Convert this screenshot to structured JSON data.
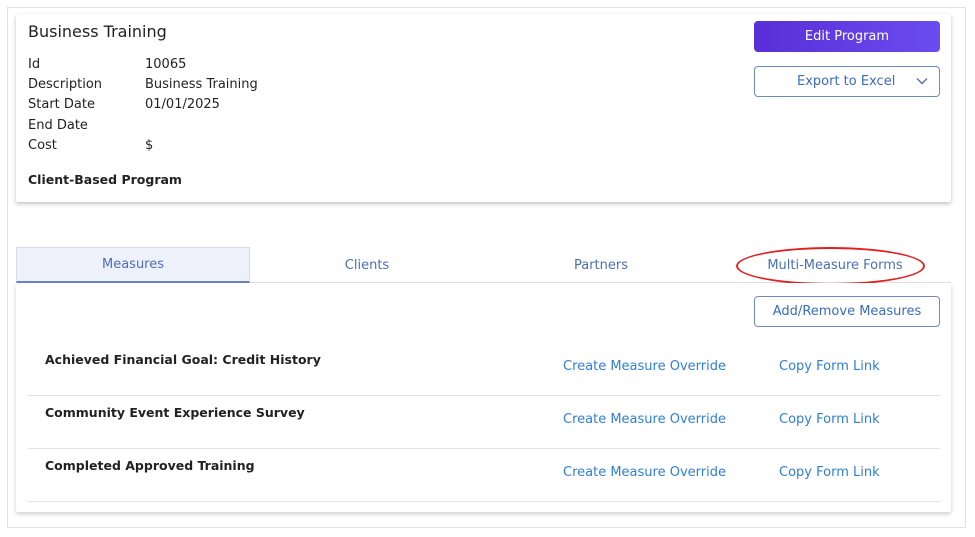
{
  "program": {
    "title": "Business Training",
    "fields": [
      {
        "label": "Id",
        "value": "10065"
      },
      {
        "label": "Description",
        "value": "Business Training"
      },
      {
        "label": "Start Date",
        "value": "01/01/2025"
      },
      {
        "label": "End Date",
        "value": ""
      },
      {
        "label": "Cost",
        "value": "$"
      }
    ],
    "type_label": "Client-Based Program"
  },
  "actions": {
    "edit_label": "Edit Program",
    "export_label": "Export to Excel",
    "export_icon": "chevron-down-icon"
  },
  "tabs": [
    {
      "label": "Measures",
      "active": true
    },
    {
      "label": "Clients",
      "active": false
    },
    {
      "label": "Partners",
      "active": false
    },
    {
      "label": "Multi-Measure Forms",
      "active": false,
      "highlighted": true
    }
  ],
  "measures": {
    "add_remove_label": "Add/Remove Measures",
    "rows": [
      {
        "name": "Achieved Financial Goal: Credit History",
        "override_label": "Create Measure Override",
        "copy_label": "Copy Form Link"
      },
      {
        "name": "Community Event Experience Survey",
        "override_label": "Create Measure Override",
        "copy_label": "Copy Form Link"
      },
      {
        "name": "Completed Approved Training",
        "override_label": "Create Measure Override",
        "copy_label": "Copy Form Link"
      }
    ]
  },
  "colors": {
    "primary_gradient_start": "#5a2ed8",
    "primary_gradient_end": "#6a4cf0",
    "link": "#2f7fd6",
    "tab_text": "#4a6fb8",
    "highlight_ellipse": "#e02020"
  }
}
